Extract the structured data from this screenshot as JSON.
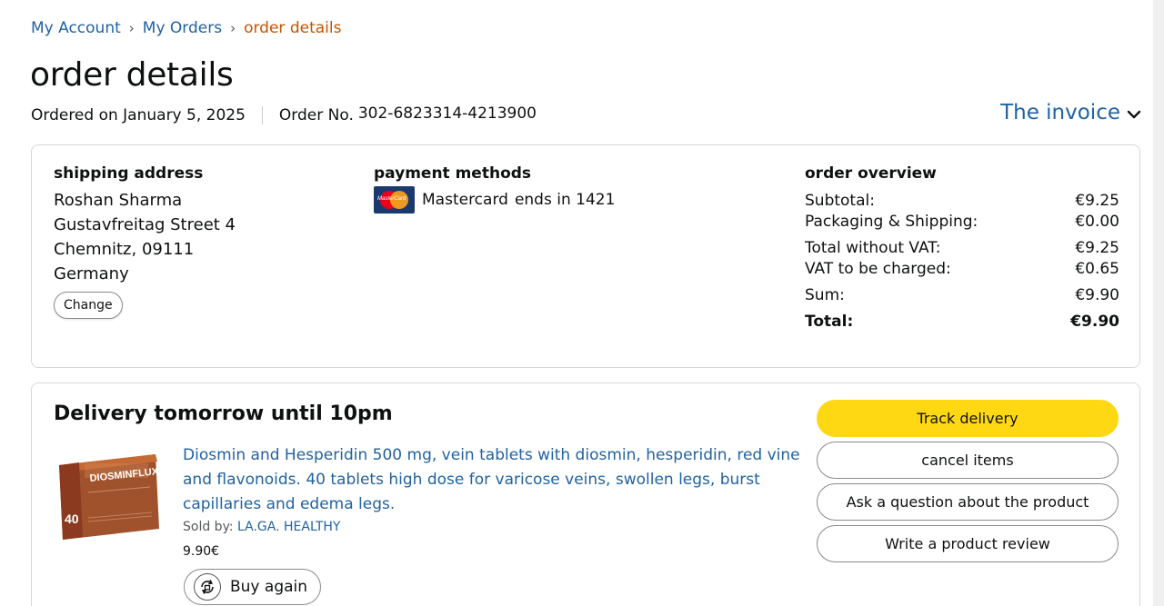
{
  "breadcrumb": {
    "items": [
      "My Account",
      "My Orders"
    ],
    "current": "order details",
    "separator": "›"
  },
  "page_title": "order details",
  "meta": {
    "ordered_on": "Ordered on January 5, 2025",
    "order_no_label": "Order No.",
    "order_no_value": "302-6823314-4213900"
  },
  "invoice": {
    "label": "The invoice",
    "icon": "chevron-down-icon"
  },
  "shipping": {
    "title": "shipping address",
    "lines": [
      "Roshan Sharma",
      "Gustavfreitag Street 4",
      "Chemnitz, 09111",
      "Germany"
    ],
    "change_label": "Change"
  },
  "payment": {
    "title": "payment methods",
    "card_logo_text": "MasterCard",
    "card_name": "Mastercard",
    "card_ending": "ends in 1421"
  },
  "overview": {
    "title": "order overview",
    "rows": [
      {
        "label": "Subtotal:",
        "value": "€9.25"
      },
      {
        "label": "Packaging & Shipping:",
        "value": "€0.00"
      },
      {
        "label": "Total without VAT:",
        "value": "€9.25"
      },
      {
        "label": "VAT to be charged:",
        "value": "€0.65"
      },
      {
        "label": "Sum:",
        "value": "€9.90"
      },
      {
        "label": "Total:",
        "value": "€9.90"
      }
    ]
  },
  "shipment": {
    "delivery_title": "Delivery tomorrow until 10pm",
    "product": {
      "title": "Diosmin and Hesperidin 500 mg, vein tablets with diosmin, hesperidin, red vine and flavonoids. 40 tablets high dose for varicose veins, swollen legs, burst capillaries and edema legs.",
      "image_brand": "DIOSMINFLUX",
      "image_count": "40",
      "sold_by_label": "Sold by:",
      "seller": "LA.GA. HEALTHY",
      "price": "9.90€",
      "buy_again_label": "Buy again"
    },
    "actions": [
      "Track delivery",
      "cancel items",
      "Ask a question about the product",
      "Write a product review"
    ]
  },
  "colors": {
    "link": "#2162a1",
    "breadcrumb_current": "#c45500",
    "primary_button": "#ffd814",
    "border": "#d5d9d9"
  }
}
